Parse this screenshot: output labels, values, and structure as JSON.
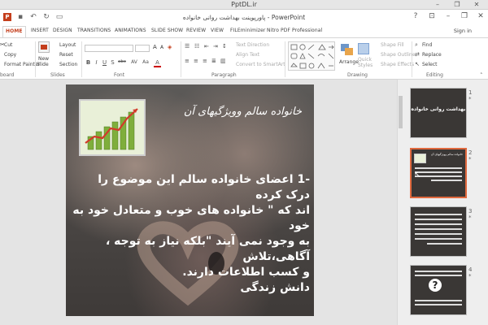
{
  "window": {
    "site_title": "PptDL.ir",
    "app_title": "پاورپوینت بهداشت روانی خانواده - PowerPoint",
    "help": "?",
    "minimize": "–",
    "restore": "❐",
    "close": "✕"
  },
  "tabs": [
    "HOME",
    "INSERT",
    "DESIGN",
    "TRANSITIONS",
    "ANIMATIONS",
    "SLIDE SHOW",
    "REVIEW",
    "VIEW",
    "FILEminimizer",
    "Nitro PDF Professional"
  ],
  "sign_in": "Sign in",
  "ribbon": {
    "clipboard": {
      "cut": "Cut",
      "copy": "Copy",
      "format_painter": "Format Painter",
      "label": "board"
    },
    "slides": {
      "new_slide_1": "New",
      "new_slide_2": "Slide",
      "layout": "Layout",
      "reset": "Reset",
      "section": "Section",
      "label": "Slides"
    },
    "font": {
      "label": "Font",
      "buttons": [
        "B",
        "I",
        "U",
        "S",
        "abc",
        "AV",
        "Aa",
        "A"
      ]
    },
    "paragraph": {
      "text_direction": "Text Direction",
      "align_text": "Align Text",
      "convert_smartart": "Convert to SmartArt",
      "label": "Paragraph"
    },
    "drawing": {
      "arrange": "Arrange",
      "quick_styles_1": "Quick",
      "quick_styles_2": "Styles",
      "shape_fill": "Shape Fill",
      "shape_outline": "Shape Outline",
      "shape_effects": "Shape Effects",
      "label": "Drawing"
    },
    "editing": {
      "find": "Find",
      "replace": "Replace",
      "select": "Select",
      "label": "Editing"
    }
  },
  "slide": {
    "title": "خانواده سالم وویژگیهای آن",
    "body_lines": [
      "-1 اعضای خانواده سالم این موضوع را درک کرده",
      "اند که \" خانواده های خوب و متعادل خود به خود",
      "به وجود نمی آیند \"بلکه نیاز به توجه ، آگاهی،تلاش",
      "و کسب اطلاعات دارند."
    ],
    "source": "دانش زندگی"
  },
  "thumbnails": [
    {
      "number": "1",
      "mark": "*",
      "title": "بهداشت روانی خانواده"
    },
    {
      "number": "2",
      "mark": "*",
      "title": "خانواده سالم وویژگیهای آن"
    },
    {
      "number": "3",
      "mark": "*"
    },
    {
      "number": "4",
      "mark": "*"
    }
  ]
}
